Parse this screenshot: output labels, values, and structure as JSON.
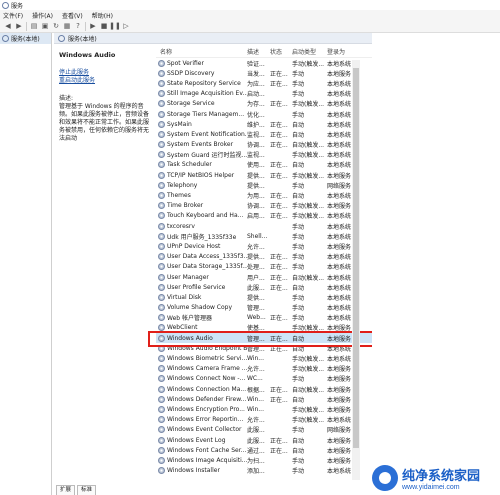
{
  "window": {
    "title": "服务"
  },
  "menu": [
    "文件(F)",
    "操作(A)",
    "查看(V)",
    "帮助(H)"
  ],
  "toolbar": {
    "icons": [
      "back-icon",
      "forward-icon",
      "list-icon",
      "properties-icon",
      "refresh-icon",
      "export-icon",
      "help-icon",
      "play-icon",
      "stop-icon",
      "pause-icon",
      "restart-icon"
    ]
  },
  "tree": {
    "item": "服务(本地)"
  },
  "panel": {
    "title": "服务(本地)"
  },
  "detail": {
    "service_name": "Windows Audio",
    "stop_link": "停止此服务",
    "restart_link": "重启动此服务",
    "desc_label": "描述:",
    "desc_text": "管理基于 Windows 的程序的音频。如果此服务被停止，音频设备和效果将不能正常工作。如果此服务被禁用，任何依赖它的服务将无法启动"
  },
  "columns": {
    "name": "名称",
    "desc": "描述",
    "status": "状态",
    "type": "启动类型",
    "logon": "登录为"
  },
  "rows": [
    {
      "name": "Spot Verifier",
      "desc": "验证...",
      "status": "",
      "type": "手动(触发...",
      "logon": "本地系统"
    },
    {
      "name": "SSDP Discovery",
      "desc": "当发...",
      "status": "正在...",
      "type": "手动",
      "logon": "本地服务"
    },
    {
      "name": "State Repository Service",
      "desc": "为应...",
      "status": "正在...",
      "type": "手动",
      "logon": "本地系统"
    },
    {
      "name": "Still Image Acquisition Ev...",
      "desc": "启动...",
      "status": "",
      "type": "手动",
      "logon": "本地系统"
    },
    {
      "name": "Storage Service",
      "desc": "为存...",
      "status": "正在...",
      "type": "手动(触发...",
      "logon": "本地系统"
    },
    {
      "name": "Storage Tiers Managem...",
      "desc": "优化...",
      "status": "",
      "type": "手动",
      "logon": "本地系统"
    },
    {
      "name": "SysMain",
      "desc": "维护...",
      "status": "正在...",
      "type": "自动",
      "logon": "本地系统"
    },
    {
      "name": "System Event Notification...",
      "desc": "监视...",
      "status": "正在...",
      "type": "自动",
      "logon": "本地系统"
    },
    {
      "name": "System Events Broker",
      "desc": "协调...",
      "status": "正在...",
      "type": "自动(触发...",
      "logon": "本地系统"
    },
    {
      "name": "System Guard 运行时监视...",
      "desc": "监视...",
      "status": "",
      "type": "手动(触发...",
      "logon": "本地系统"
    },
    {
      "name": "Task Scheduler",
      "desc": "使用...",
      "status": "正在...",
      "type": "自动",
      "logon": "本地系统"
    },
    {
      "name": "TCP/IP NetBIOS Helper",
      "desc": "提供...",
      "status": "正在...",
      "type": "手动(触发...",
      "logon": "本地服务"
    },
    {
      "name": "Telephony",
      "desc": "提供...",
      "status": "",
      "type": "手动",
      "logon": "网络服务"
    },
    {
      "name": "Themes",
      "desc": "为用...",
      "status": "正在...",
      "type": "自动",
      "logon": "本地系统"
    },
    {
      "name": "Time Broker",
      "desc": "协调...",
      "status": "正在...",
      "type": "手动(触发...",
      "logon": "本地服务"
    },
    {
      "name": "Touch Keyboard and Ha...",
      "desc": "启用...",
      "status": "正在...",
      "type": "手动(触发...",
      "logon": "本地系统"
    },
    {
      "name": "txcoresrv",
      "desc": "",
      "status": "",
      "type": "手动",
      "logon": "本地系统"
    },
    {
      "name": "Udk 用户服务_1335f33e",
      "desc": "Shell...",
      "status": "",
      "type": "手动",
      "logon": "本地系统"
    },
    {
      "name": "UPnP Device Host",
      "desc": "允许...",
      "status": "",
      "type": "手动",
      "logon": "本地服务"
    },
    {
      "name": "User Data Access_1335f3...",
      "desc": "提供...",
      "status": "正在...",
      "type": "手动",
      "logon": "本地系统"
    },
    {
      "name": "User Data Storage_1335f...",
      "desc": "处理...",
      "status": "正在...",
      "type": "手动",
      "logon": "本地系统"
    },
    {
      "name": "User Manager",
      "desc": "用户...",
      "status": "正在...",
      "type": "自动(触发...",
      "logon": "本地系统"
    },
    {
      "name": "User Profile Service",
      "desc": "此服...",
      "status": "正在...",
      "type": "自动",
      "logon": "本地系统"
    },
    {
      "name": "Virtual Disk",
      "desc": "提供...",
      "status": "",
      "type": "手动",
      "logon": "本地系统"
    },
    {
      "name": "Volume Shadow Copy",
      "desc": "管理...",
      "status": "",
      "type": "手动",
      "logon": "本地系统"
    },
    {
      "name": "Web 帐户管理器",
      "desc": "Web...",
      "status": "正在...",
      "type": "手动",
      "logon": "本地系统"
    },
    {
      "name": "WebClient",
      "desc": "使基...",
      "status": "",
      "type": "手动(触发...",
      "logon": "本地服务"
    },
    {
      "name": "Windows Audio",
      "desc": "管理...",
      "status": "正在...",
      "type": "自动",
      "logon": "本地服务"
    },
    {
      "name": "Windows Audio Endpoint B...",
      "desc": "管理...",
      "status": "正在...",
      "type": "自动",
      "logon": "本地系统"
    },
    {
      "name": "Windows Biometric Servi...",
      "desc": "Win...",
      "status": "",
      "type": "手动(触发...",
      "logon": "本地系统"
    },
    {
      "name": "Windows Camera Frame ...",
      "desc": "允许...",
      "status": "",
      "type": "手动(触发...",
      "logon": "本地服务"
    },
    {
      "name": "Windows Connect Now -...",
      "desc": "WC...",
      "status": "",
      "type": "手动",
      "logon": "本地服务"
    },
    {
      "name": "Windows Connection Ma...",
      "desc": "根据...",
      "status": "正在...",
      "type": "自动(触发...",
      "logon": "本地服务"
    },
    {
      "name": "Windows Defender Firew...",
      "desc": "Win...",
      "status": "正在...",
      "type": "自动",
      "logon": "本地服务"
    },
    {
      "name": "Windows Encryption Pro...",
      "desc": "Win...",
      "status": "",
      "type": "手动(触发...",
      "logon": "本地服务"
    },
    {
      "name": "Windows Error Reportin...",
      "desc": "允许...",
      "status": "",
      "type": "手动(触发...",
      "logon": "本地系统"
    },
    {
      "name": "Windows Event Collector",
      "desc": "此服...",
      "status": "",
      "type": "手动",
      "logon": "网络服务"
    },
    {
      "name": "Windows Event Log",
      "desc": "此服...",
      "status": "正在...",
      "type": "自动",
      "logon": "本地服务"
    },
    {
      "name": "Windows Font Cache Ser...",
      "desc": "通过...",
      "status": "正在...",
      "type": "自动",
      "logon": "本地服务"
    },
    {
      "name": "Windows Image Acquisiti...",
      "desc": "为扫...",
      "status": "",
      "type": "手动",
      "logon": "本地服务"
    },
    {
      "name": "Windows Installer",
      "desc": "添加...",
      "status": "",
      "type": "手动",
      "logon": "本地系统"
    }
  ],
  "bottom_tabs": [
    "扩展",
    "标准"
  ],
  "watermark": {
    "title": "纯净系统家园",
    "url": "www.yidaimei.com"
  }
}
